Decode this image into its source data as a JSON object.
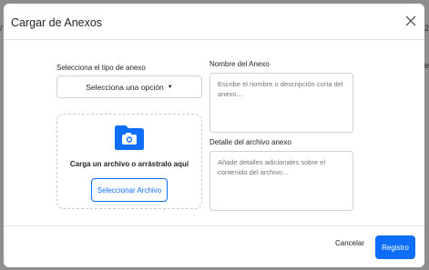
{
  "backdrop": {
    "left_fragment": "/",
    "right_fragment": "2",
    "right_fragment_2": "e"
  },
  "modal": {
    "title": "Cargar de Anexos",
    "close_icon": "close-icon"
  },
  "form": {
    "type_label": "Selecciona el tipo de anexo",
    "type_select_value": "Selecciona una opción",
    "dropzone": {
      "icon": "folder-camera-icon",
      "text": "Carga un archivo o arrástralo aquí",
      "button_label": "Seleccionar Archivo"
    },
    "name_label": "Nombre del Anexo",
    "name_placeholder": "Escribe el nombre o descripción corta del anexo...",
    "detail_label": "Detalle del archivo anexo",
    "detail_placeholder": "Añade detalles adicionales sobre el contenido del archivo..."
  },
  "footer": {
    "cancel_label": "Cancelar",
    "submit_label": "Registro"
  },
  "colors": {
    "primary": "#0d6efd",
    "backdrop": "#8e8e8e"
  }
}
